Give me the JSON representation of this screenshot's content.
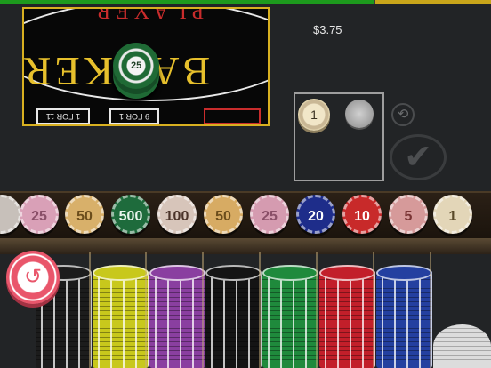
{
  "header": {
    "balance": "$3.75",
    "bet_progress": 0.76
  },
  "table_view": {
    "main_word": "BANKER",
    "top_word": "PLAYER",
    "boxes": [
      "1 FOR 11",
      "9 FOR 1",
      ""
    ],
    "chip_value": "25"
  },
  "bet": {
    "chip_value": "1",
    "coin_value": ""
  },
  "rail_chips": [
    {
      "value": "",
      "color": "#c7c0ba",
      "text_color": "#7a6e66"
    },
    {
      "value": "25",
      "color": "#d9a0b7",
      "text_color": "#8a4f68"
    },
    {
      "value": "50",
      "color": "#d8b06a",
      "text_color": "#6b4d1c"
    },
    {
      "value": "500",
      "color": "#1e6b3c",
      "text_color": "#e9f5ee"
    },
    {
      "value": "100",
      "color": "#d7c5ba",
      "text_color": "#4a3329"
    },
    {
      "value": "50",
      "color": "#d7ab63",
      "text_color": "#6b4d1c"
    },
    {
      "value": "25",
      "color": "#d59bb0",
      "text_color": "#8a4f68"
    },
    {
      "value": "20",
      "color": "#1e2d8a",
      "text_color": "#ffffff"
    },
    {
      "value": "10",
      "color": "#c82a2a",
      "text_color": "#ffffff"
    },
    {
      "value": "5",
      "color": "#d69a9a",
      "text_color": "#7a3535"
    },
    {
      "value": "1",
      "color": "#e3d6b8",
      "text_color": "#5a4a2a"
    }
  ],
  "stacks": [
    {
      "name": "black",
      "color": "#1c1c1c"
    },
    {
      "name": "yellow",
      "color": "#c8c81c"
    },
    {
      "name": "purple",
      "color": "#8a3fa0"
    },
    {
      "name": "black",
      "color": "#141414"
    },
    {
      "name": "green",
      "color": "#1f8a3c"
    },
    {
      "name": "red",
      "color": "#c21f2a"
    },
    {
      "name": "blue",
      "color": "#2440a0"
    }
  ],
  "controls": {
    "rebet_icon": "rebet-icon",
    "confirm_icon": "checkmark-icon",
    "undo_icon": "undo-icon"
  }
}
